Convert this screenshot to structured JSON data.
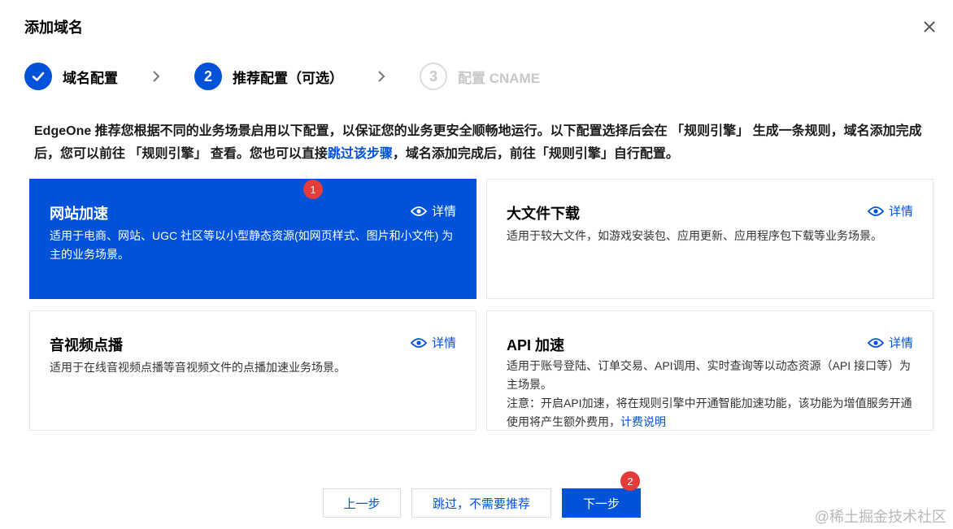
{
  "dialog": {
    "title": "添加域名",
    "close_icon": "close-icon"
  },
  "steps": [
    {
      "number": "1",
      "label": "域名配置",
      "status": "done",
      "icon": "check-icon"
    },
    {
      "number": "2",
      "label": "推荐配置（可选）",
      "status": "active"
    },
    {
      "number": "3",
      "label": "配置 CNAME",
      "status": "pending"
    }
  ],
  "intro": {
    "text_before": "EdgeOne 推荐您根据不同的业务场景启用以下配置，以保证您的业务更安全顺畅地运行。以下配置选择后会在 「规则引擎」 生成一条规则，域名添加完成后，您可以前往 「规则引擎」 查看。您也可以直接",
    "link": "跳过该步骤",
    "text_after": "，域名添加完成后，前往「规则引擎」自行配置。"
  },
  "cards": [
    {
      "title": "网站加速",
      "detail": "详情",
      "desc": "适用于电商、网站、UGC 社区等以小型静态资源(如网页样式、图片和小文件) 为主的业务场景。",
      "selected": true
    },
    {
      "title": "大文件下载",
      "detail": "详情",
      "desc": "适用于较大文件，如游戏安装包、应用更新、应用程序包下载等业务场景。",
      "selected": false
    },
    {
      "title": "音视频点播",
      "detail": "详情",
      "desc": "适用于在线音视频点播等音视频文件的点播加速业务场景。",
      "selected": false
    },
    {
      "title": "API 加速",
      "detail": "详情",
      "desc": "适用于账号登陆、订单交易、API调用、实时查询等以动态资源（API 接口等）为主场景。",
      "note": "注意：开启API加速，将在规则引擎中开通智能加速功能，该功能为增值服务开通使用将产生额外费用，",
      "note_link": "计费说明",
      "selected": false
    }
  ],
  "badges": [
    "1",
    "2"
  ],
  "buttons": {
    "prev": "上一步",
    "skip": "跳过，不需要推荐",
    "next": "下一步"
  },
  "watermark": "@稀土掘金技术社区",
  "colors": {
    "primary": "#0052d9",
    "badge": "#e63b3b"
  }
}
